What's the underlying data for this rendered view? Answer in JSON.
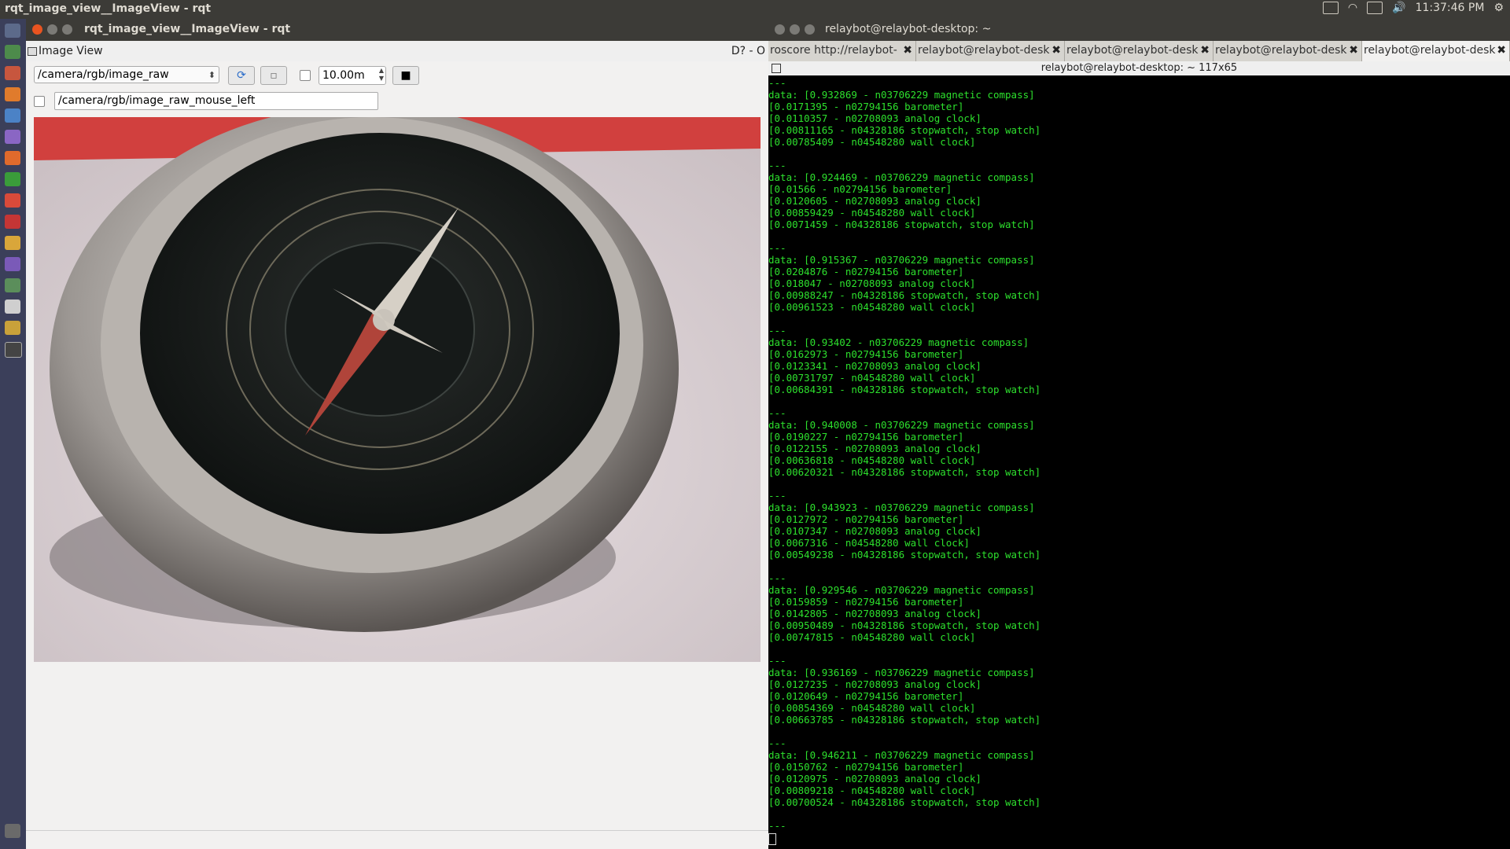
{
  "topbar": {
    "title": "rqt_image_view__ImageView - rqt",
    "time": "11:37:46 PM"
  },
  "launcher": {
    "items": [
      "dash-icon",
      "terminal-icon",
      "files-icon",
      "firefox-icon",
      "thunderbird-icon",
      "media-icon",
      "software-icon",
      "calc-icon",
      "settings-icon",
      "monitor-icon",
      "text-editor-icon",
      "image-viewer-icon",
      "rqt-icon",
      "screen-icon",
      "camera-icon",
      "terminal-small-icon",
      "trash-icon"
    ]
  },
  "rqt": {
    "window_title": "rqt_image_view__ImageView - rqt",
    "plugin_title": "Image View",
    "plugin_controls": "D?  - O",
    "topic": "/camera/rgb/image_raw",
    "timeout_value": "10.00m",
    "mouse_topic": "/camera/rgb/image_raw_mouse_left"
  },
  "terminal": {
    "window_title": "relaybot@relaybot-desktop: ~",
    "subtitle": "relaybot@relaybot-desktop: ~ 117x65",
    "tabs": [
      {
        "label": "roscore http://relaybot-"
      },
      {
        "label": "relaybot@relaybot-desk"
      },
      {
        "label": "relaybot@relaybot-desk"
      },
      {
        "label": "relaybot@relaybot-desk"
      },
      {
        "label": "relaybot@relaybot-desk"
      }
    ],
    "lines": [
      "---",
      "data: [0.932869 - n03706229 magnetic compass]",
      "[0.0171395 - n02794156 barometer]",
      "[0.0110357 - n02708093 analog clock]",
      "[0.00811165 - n04328186 stopwatch, stop watch]",
      "[0.00785409 - n04548280 wall clock]",
      "",
      "---",
      "data: [0.924469 - n03706229 magnetic compass]",
      "[0.01566 - n02794156 barometer]",
      "[0.0120605 - n02708093 analog clock]",
      "[0.00859429 - n04548280 wall clock]",
      "[0.0071459 - n04328186 stopwatch, stop watch]",
      "",
      "---",
      "data: [0.915367 - n03706229 magnetic compass]",
      "[0.0204876 - n02794156 barometer]",
      "[0.018047 - n02708093 analog clock]",
      "[0.00988247 - n04328186 stopwatch, stop watch]",
      "[0.00961523 - n04548280 wall clock]",
      "",
      "---",
      "data: [0.93402 - n03706229 magnetic compass]",
      "[0.0162973 - n02794156 barometer]",
      "[0.0123341 - n02708093 analog clock]",
      "[0.00731797 - n04548280 wall clock]",
      "[0.00684391 - n04328186 stopwatch, stop watch]",
      "",
      "---",
      "data: [0.940008 - n03706229 magnetic compass]",
      "[0.0190227 - n02794156 barometer]",
      "[0.0122155 - n02708093 analog clock]",
      "[0.00636818 - n04548280 wall clock]",
      "[0.00620321 - n04328186 stopwatch, stop watch]",
      "",
      "---",
      "data: [0.943923 - n03706229 magnetic compass]",
      "[0.0127972 - n02794156 barometer]",
      "[0.0107347 - n02708093 analog clock]",
      "[0.0067316 - n04548280 wall clock]",
      "[0.00549238 - n04328186 stopwatch, stop watch]",
      "",
      "---",
      "data: [0.929546 - n03706229 magnetic compass]",
      "[0.0159859 - n02794156 barometer]",
      "[0.0142805 - n02708093 analog clock]",
      "[0.00950489 - n04328186 stopwatch, stop watch]",
      "[0.00747815 - n04548280 wall clock]",
      "",
      "---",
      "data: [0.936169 - n03706229 magnetic compass]",
      "[0.0127235 - n02708093 analog clock]",
      "[0.0120649 - n02794156 barometer]",
      "[0.00854369 - n04548280 wall clock]",
      "[0.00663785 - n04328186 stopwatch, stop watch]",
      "",
      "---",
      "data: [0.946211 - n03706229 magnetic compass]",
      "[0.0150762 - n02794156 barometer]",
      "[0.0120975 - n02708093 analog clock]",
      "[0.00809218 - n04548280 wall clock]",
      "[0.00700524 - n04328186 stopwatch, stop watch]",
      "",
      "---"
    ]
  },
  "colors": {
    "terminal_text": "#2de02d",
    "titlebar": "#3c3b37",
    "launcher": "#3b3f5a",
    "close_button": "#e95420"
  }
}
